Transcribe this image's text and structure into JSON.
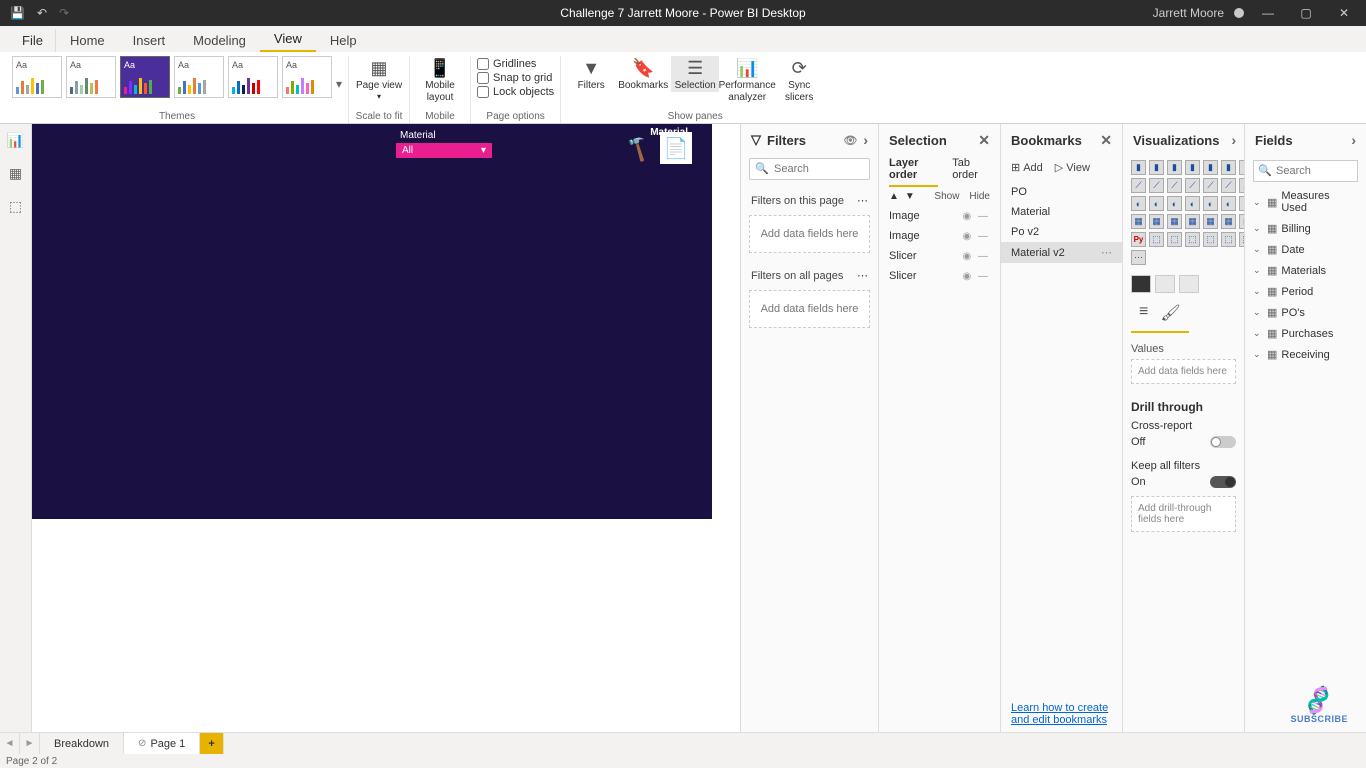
{
  "titlebar": {
    "title": "Challenge 7 Jarrett Moore - Power BI Desktop",
    "username": "Jarrett Moore"
  },
  "menu": {
    "file": "File",
    "tabs": [
      "Home",
      "Insert",
      "Modeling",
      "View",
      "Help"
    ],
    "active": "View"
  },
  "ribbon": {
    "themes_label": "Themes",
    "scale_label": "Scale to fit",
    "mobile_label": "Mobile",
    "page_options_label": "Page options",
    "show_panes_label": "Show panes",
    "page_view": "Page view",
    "mobile_layout": "Mobile layout",
    "gridlines": "Gridlines",
    "snap": "Snap to grid",
    "lock": "Lock objects",
    "filters": "Filters",
    "bookmarks": "Bookmarks",
    "selection": "Selection",
    "perf": "Performance analyzer",
    "sync": "Sync slicers"
  },
  "canvas": {
    "material_header": "Material",
    "slicer_title": "Material",
    "slicer_value": "All"
  },
  "filters": {
    "title": "Filters",
    "search_placeholder": "Search",
    "on_page": "Filters on this page",
    "on_all": "Filters on all pages",
    "add_here": "Add data fields here"
  },
  "selection": {
    "title": "Selection",
    "layer": "Layer order",
    "taborder": "Tab order",
    "show": "Show",
    "hide": "Hide",
    "items": [
      "Image",
      "Image",
      "Slicer",
      "Slicer"
    ]
  },
  "bookmarks": {
    "title": "Bookmarks",
    "add": "Add",
    "view": "View",
    "items": [
      "PO",
      "Material",
      "Po v2",
      "Material v2"
    ],
    "link": "Learn how to create and edit bookmarks"
  },
  "viz": {
    "title": "Visualizations",
    "values": "Values",
    "add_fields": "Add data fields here",
    "drill": "Drill through",
    "cross": "Cross-report",
    "off": "Off",
    "keep": "Keep all filters",
    "on": "On",
    "add_drill": "Add drill-through fields here"
  },
  "fields": {
    "title": "Fields",
    "search_placeholder": "Search",
    "items": [
      "Measures Used",
      "Billing",
      "Date",
      "Materials",
      "Period",
      "PO's",
      "Purchases",
      "Receiving"
    ]
  },
  "tabs": {
    "pages": [
      "Breakdown",
      "Page 1"
    ]
  },
  "status": "Page 2 of 2",
  "subscribe": "SUBSCRIBE"
}
